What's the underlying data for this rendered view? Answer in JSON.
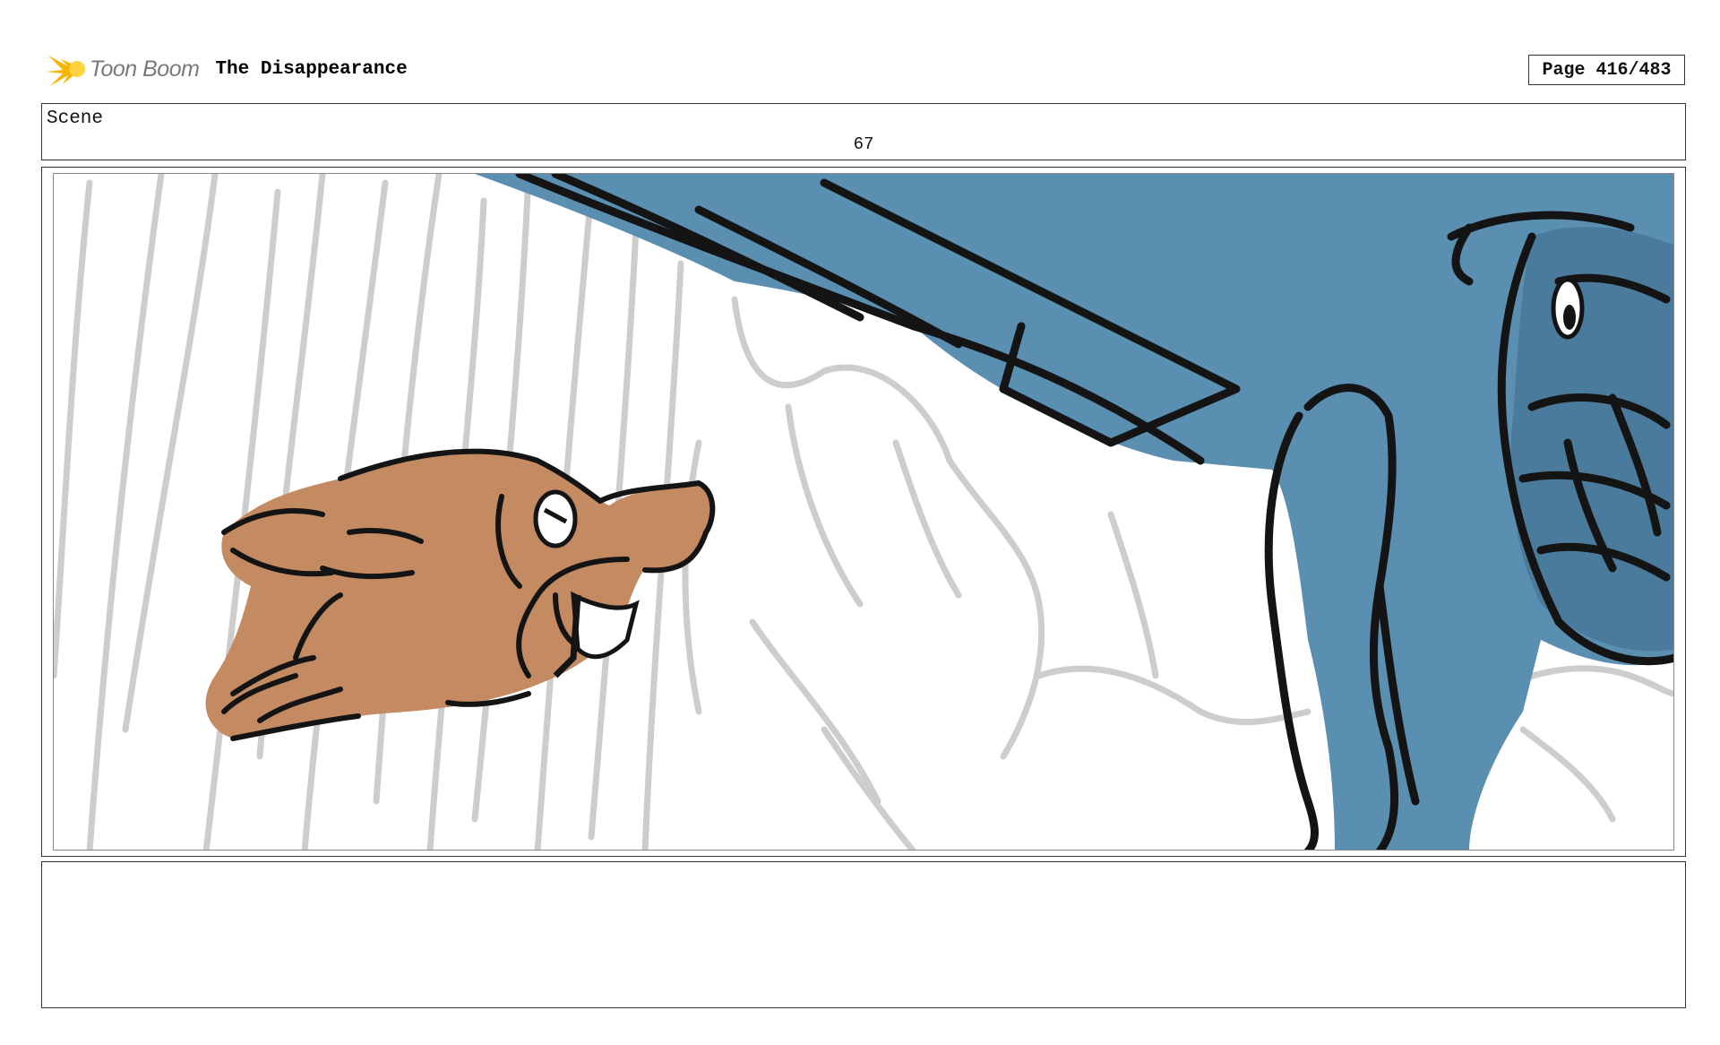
{
  "header": {
    "brand": "Toon Boom",
    "project_title": "The Disappearance",
    "page_label": "Page 416/483"
  },
  "scene": {
    "label": "Scene",
    "number": "67"
  },
  "panel": {
    "background_color": "#ffffff",
    "dog_color": "#c48a62",
    "figure_color": "#5b8fb2",
    "sketch_color": "#c4c4c4",
    "ink_color": "#141414"
  },
  "notes": {
    "text": ""
  }
}
